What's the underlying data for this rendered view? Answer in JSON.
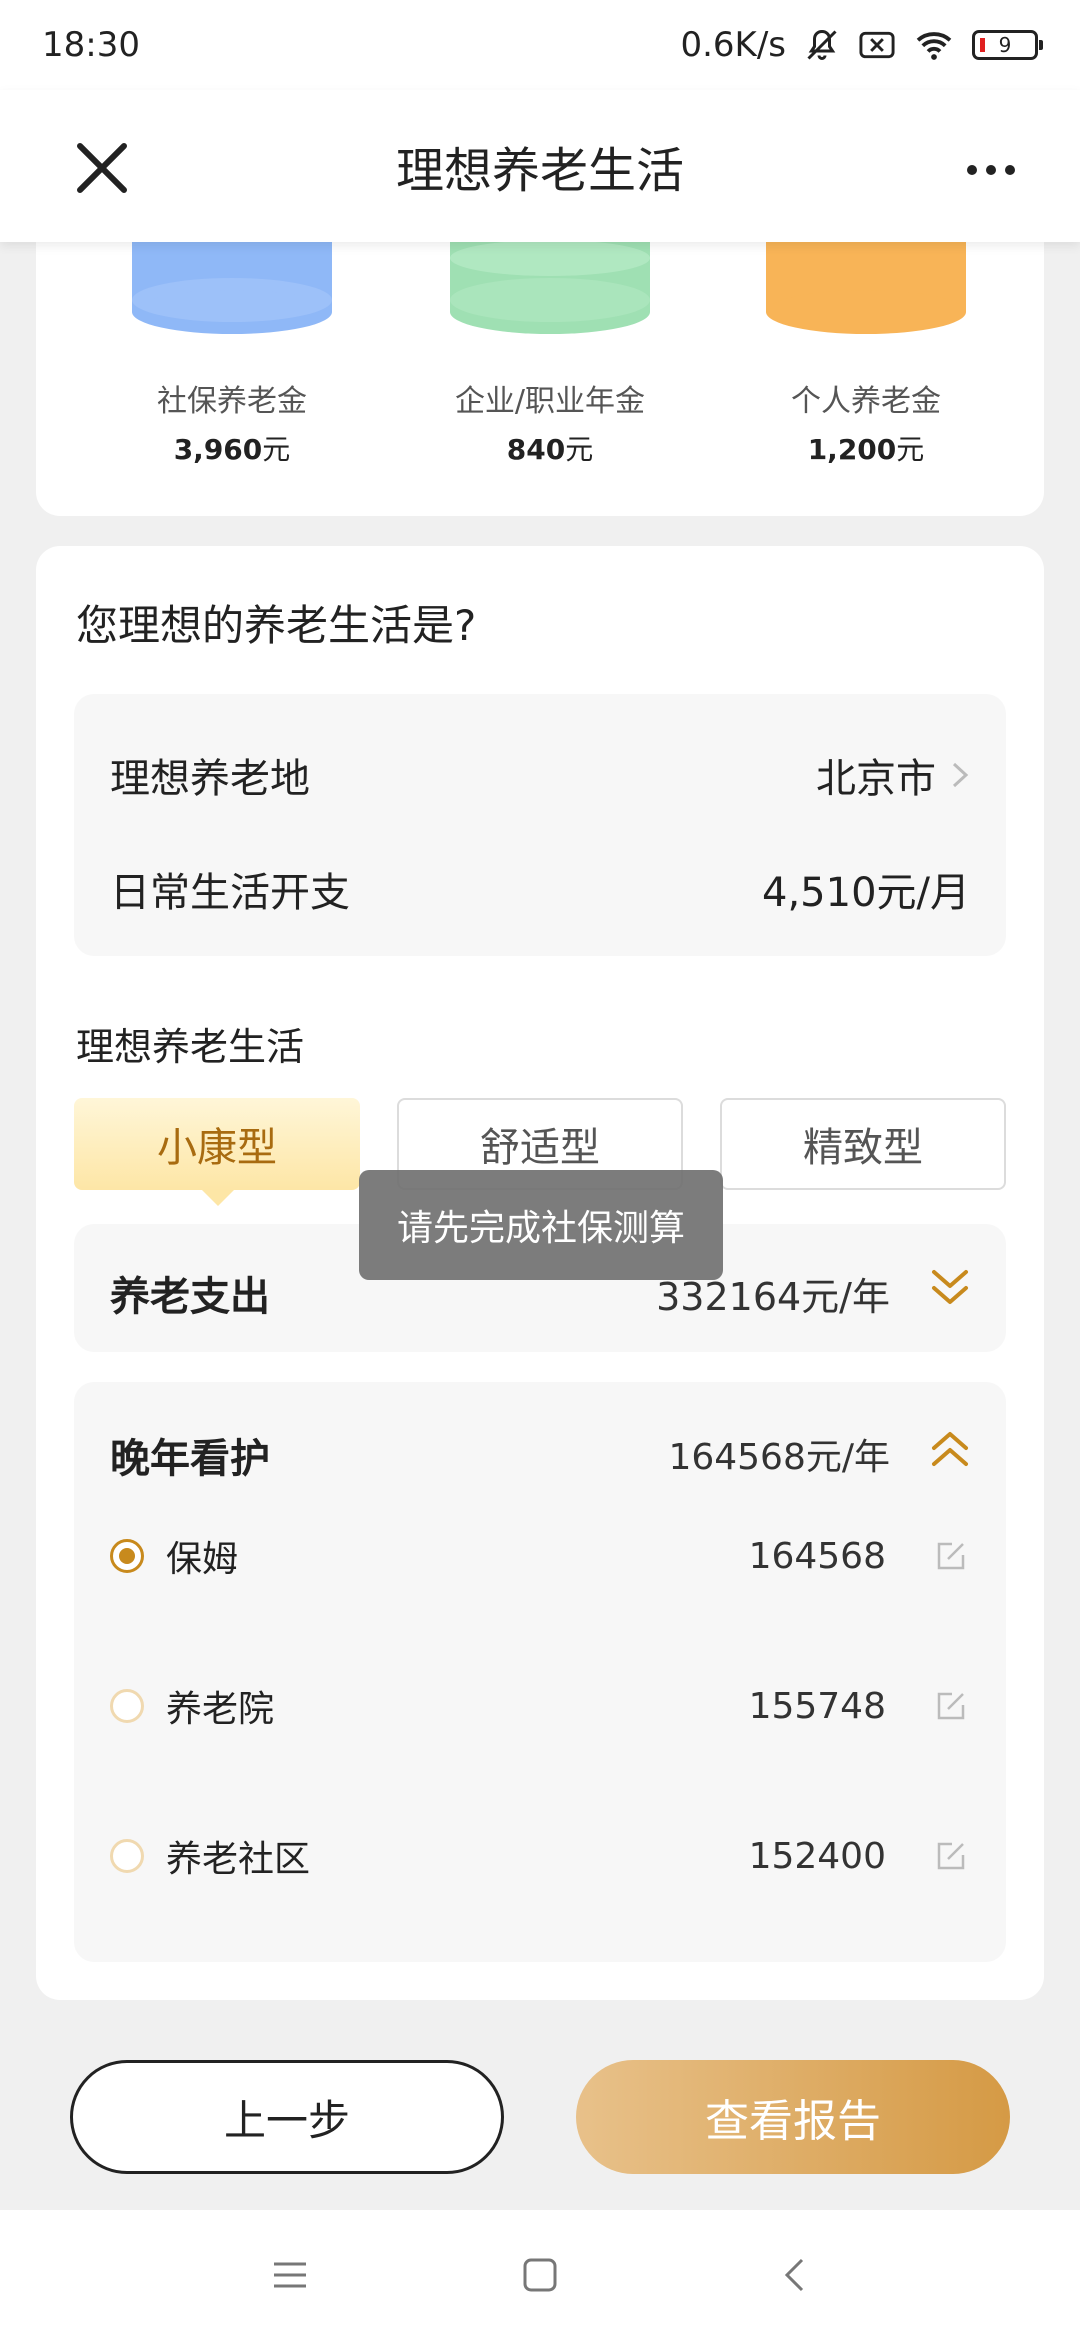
{
  "status_bar": {
    "time": "18:30",
    "net_speed": "0.6K/s",
    "battery": "9"
  },
  "header": {
    "title": "理想养老生活"
  },
  "pensions": [
    {
      "label": "社保养老金",
      "amount": "3,960",
      "unit": "元",
      "color": "#8fb8f7"
    },
    {
      "label": "企业/职业年金",
      "amount": "840",
      "unit": "元",
      "color": "#9fe0b3"
    },
    {
      "label": "个人养老金",
      "amount": "1,200",
      "unit": "元",
      "color": "#f8b457"
    }
  ],
  "question": "您理想的养老生活是?",
  "info": {
    "place_label": "理想养老地",
    "place_value": "北京市",
    "expense_label": "日常生活开支",
    "expense_value": "4,510元/月"
  },
  "lifestyle": {
    "label": "理想养老生活",
    "tabs": [
      "小康型",
      "舒适型",
      "精致型"
    ],
    "selected": "小康型"
  },
  "spending": {
    "title": "养老支出",
    "value": "332164元/年"
  },
  "care": {
    "title": "晚年看护",
    "value": "164568元/年",
    "options": [
      {
        "name": "保姆",
        "amount": "164568",
        "selected": true
      },
      {
        "name": "养老院",
        "amount": "155748",
        "selected": false
      },
      {
        "name": "养老社区",
        "amount": "152400",
        "selected": false
      }
    ]
  },
  "toast": "请先完成社保测算",
  "buttons": {
    "prev": "上一步",
    "report": "查看报告"
  },
  "colors": {
    "accent": "#c88a1d",
    "button_gradient_start": "#e8c18a",
    "button_gradient_end": "#d59a45"
  }
}
